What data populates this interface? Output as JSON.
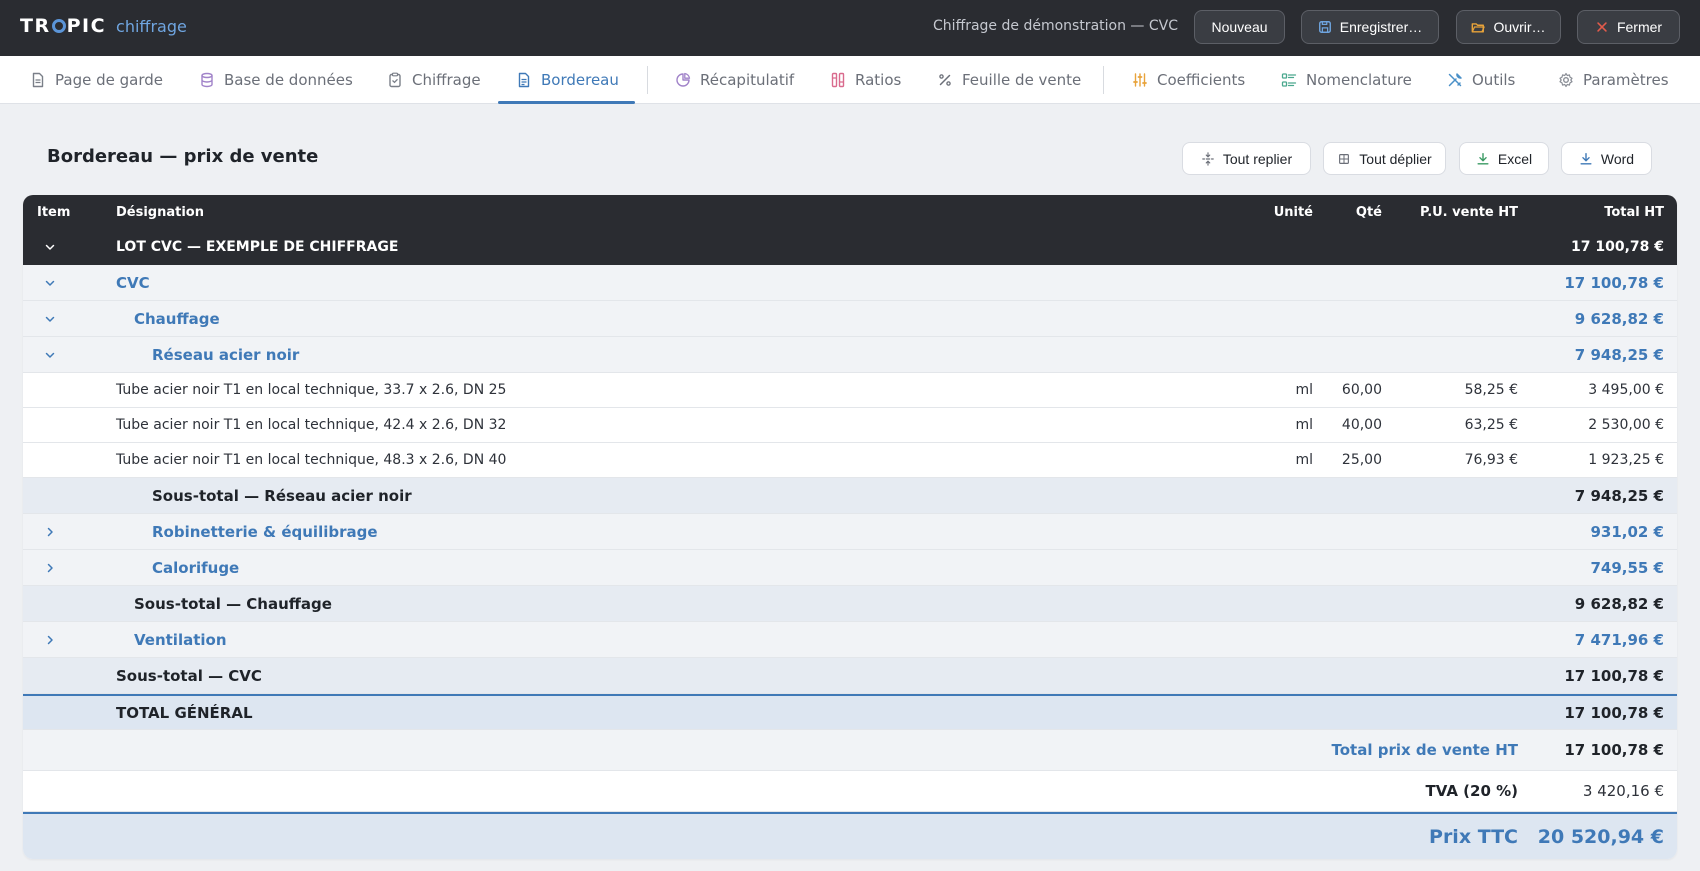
{
  "app": {
    "logo_text_left": "TR",
    "logo_text_right": "PIC",
    "logo_sub": "chiffrage",
    "document_title": "Chiffrage de démonstration — CVC"
  },
  "toolbar": {
    "new_label": "Nouveau",
    "save_label": "Enregistrer…",
    "open_label": "Ouvrir…",
    "close_label": "Fermer"
  },
  "tabs": [
    {
      "label": "Page de garde",
      "icon": "document-icon"
    },
    {
      "label": "Base de données",
      "icon": "database-icon"
    },
    {
      "label": "Chiffrage",
      "icon": "clipboard-icon"
    },
    {
      "label": "Bordereau",
      "icon": "file-text-icon",
      "active": true
    },
    {
      "label": "Récapitulatif",
      "icon": "pie-chart-icon"
    },
    {
      "label": "Ratios",
      "icon": "ratio-icon"
    },
    {
      "label": "Feuille de vente",
      "icon": "percent-icon"
    },
    {
      "label": "Coefficients",
      "icon": "sliders-icon"
    },
    {
      "label": "Nomenclature",
      "icon": "list-icon"
    },
    {
      "label": "Outils",
      "icon": "tools-icon"
    },
    {
      "label": "Paramètres",
      "icon": "gear-icon"
    }
  ],
  "page": {
    "title": "Bordereau — prix de vente",
    "collapse_all": "Tout replier",
    "expand_all": "Tout déplier",
    "export_excel": "Excel",
    "export_word": "Word"
  },
  "table": {
    "columns": {
      "item": "Item",
      "designation": "Désignation",
      "unit": "Unité",
      "qty": "Qté",
      "unit_price": "P.U. vente HT",
      "total": "Total HT"
    },
    "lot": {
      "label": "LOT CVC — EXEMPLE DE CHIFFRAGE",
      "total": "17 100,78 €"
    },
    "cvc": {
      "label": "CVC",
      "total": "17 100,78 €"
    },
    "chauffage": {
      "label": "Chauffage",
      "total": "9 628,82 €"
    },
    "reseau": {
      "label": "Réseau acier noir",
      "total": "7 948,25 €"
    },
    "items": [
      {
        "designation": "Tube acier noir T1 en local technique, 33.7 x 2.6, DN 25",
        "unit": "ml",
        "qty": "60,00",
        "unit_price": "58,25 €",
        "total": "3 495,00 €"
      },
      {
        "designation": "Tube acier noir T1 en local technique, 42.4 x 2.6, DN 32",
        "unit": "ml",
        "qty": "40,00",
        "unit_price": "63,25 €",
        "total": "2 530,00 €"
      },
      {
        "designation": "Tube acier noir T1 en local technique, 48.3 x 2.6, DN 40",
        "unit": "ml",
        "qty": "25,00",
        "unit_price": "76,93 €",
        "total": "1 923,25 €"
      }
    ],
    "subtotal_reseau": {
      "label": "Sous-total — Réseau acier noir",
      "total": "7 948,25 €"
    },
    "robinetterie": {
      "label": "Robinetterie & équilibrage",
      "total": "931,02 €"
    },
    "calorifuge": {
      "label": "Calorifuge",
      "total": "749,55 €"
    },
    "subtotal_chauffage": {
      "label": "Sous-total — Chauffage",
      "total": "9 628,82 €"
    },
    "ventilation": {
      "label": "Ventilation",
      "total": "7 471,96 €"
    },
    "subtotal_cvc": {
      "label": "Sous-total — CVC",
      "total": "17 100,78 €"
    },
    "grand_total": {
      "label": "TOTAL GÉNÉRAL",
      "total": "17 100,78 €"
    }
  },
  "summary": {
    "total_ht_label": "Total prix de vente HT",
    "total_ht": "17 100,78 €",
    "tva_label": "TVA (20 %)",
    "tva": "3 420,16 €",
    "ttc_label": "Prix TTC",
    "ttc": "20 520,94 €"
  },
  "colors": {
    "topbar": "#2a2c31",
    "accent": "#3f79b7",
    "group_bg": "#f1f3f6",
    "subtotal_bg": "#e6ebf2"
  }
}
